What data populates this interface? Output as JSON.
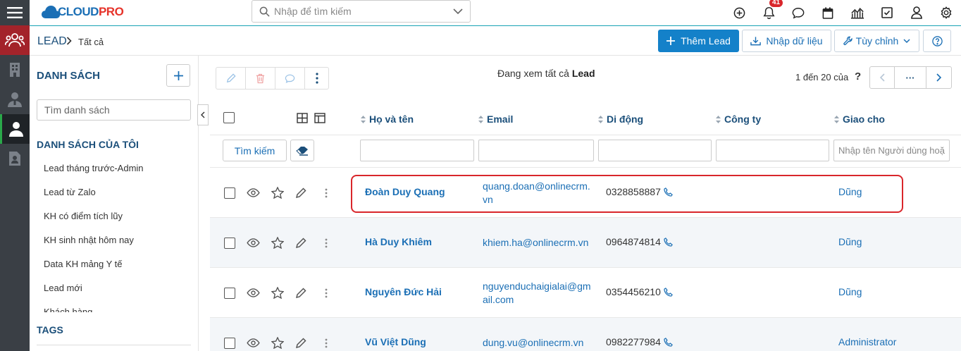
{
  "header": {
    "logo_text_cloud": "CLOUD",
    "logo_text_pro": "PRO",
    "search_placeholder": "Nhập để tìm kiếm",
    "notification_count": "41"
  },
  "breadcrumb": {
    "module": "LEAD",
    "current": "Tất cả"
  },
  "toolbar": {
    "add_label": "Thêm Lead",
    "import_label": "Nhập dữ liệu",
    "customize_label": "Tùy chỉnh"
  },
  "sidebar": {
    "title": "DANH SÁCH",
    "search_placeholder": "Tìm danh sách",
    "my_lists_title": "DANH SÁCH CỦA TÔI",
    "items": [
      {
        "label": "Lead tháng trước-Admin"
      },
      {
        "label": "Lead từ Zalo"
      },
      {
        "label": "KH có điểm tích lũy"
      },
      {
        "label": "KH sinh nhật hôm nay"
      },
      {
        "label": "Data KH mảng Y tế"
      },
      {
        "label": "Lead mới"
      },
      {
        "label": "Khách hàng"
      }
    ],
    "tags_title": "TAGS"
  },
  "list": {
    "viewing_prefix": "Đang xem tất cả",
    "viewing_module": "Lead",
    "pagination": "1 đến 20 của",
    "pagination_help": "?",
    "pager_more": "···",
    "columns": {
      "name": "Họ và tên",
      "email": "Email",
      "mobile": "Di động",
      "company": "Công ty",
      "assigned": "Giao cho"
    },
    "filter": {
      "search_button": "Tìm kiếm",
      "assigned_placeholder": "Nhập tên Người dùng hoặc Nhóm"
    },
    "rows": [
      {
        "name": "Đoàn Duy Quang",
        "email": "quang.doan@onlinecrm.vn",
        "mobile": "0328858887",
        "company": "",
        "assigned": "Dũng"
      },
      {
        "name": "Hà Duy Khiêm",
        "email": "khiem.ha@onlinecrm.vn",
        "mobile": "0964874814",
        "company": "",
        "assigned": "Dũng"
      },
      {
        "name": "Nguyên Đức Hải",
        "email": "nguyenduchaigialai@gmail.com",
        "mobile": "0354456210",
        "company": "",
        "assigned": "Dũng"
      },
      {
        "name": "Vũ Việt Dũng",
        "email": "dung.vu@onlinecrm.vn",
        "mobile": "0982277984",
        "company": "",
        "assigned": "Administrator"
      }
    ]
  },
  "colors": {
    "primary": "#1481c9",
    "link": "#1b6fb5",
    "heading": "#1b4f7a",
    "rail": "#3a3f45",
    "rail_active_group": "#a3232a",
    "highlight": "#d9262b"
  }
}
